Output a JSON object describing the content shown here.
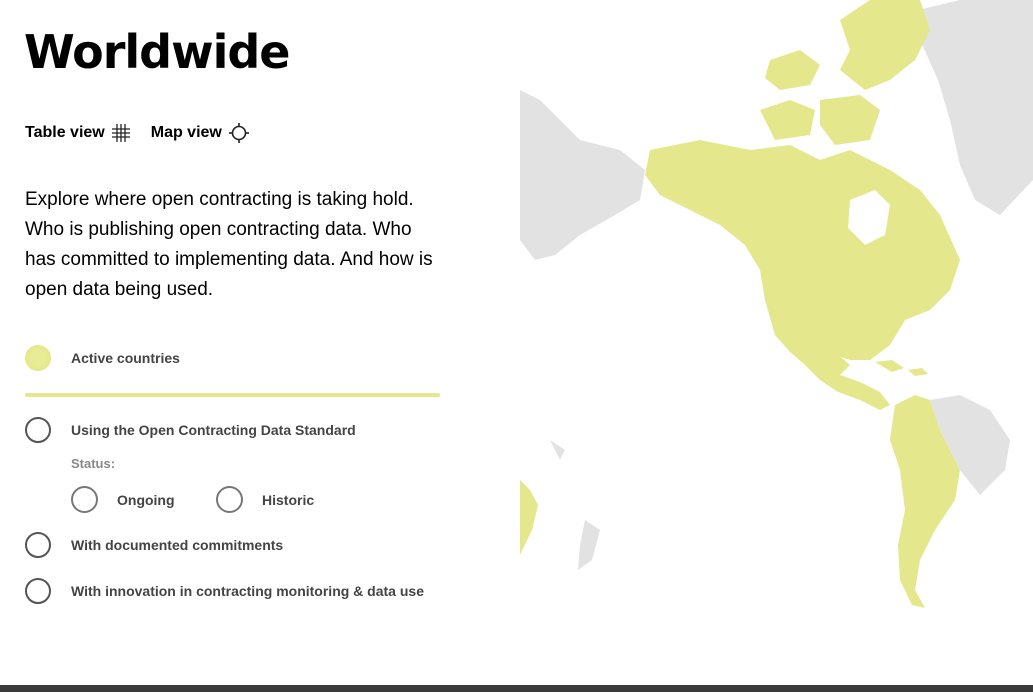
{
  "page": {
    "title": "Worldwide"
  },
  "views": {
    "table_label": "Table view",
    "table_icon": "grid-icon",
    "map_label": "Map view",
    "map_icon": "crosshair-icon"
  },
  "intro": "Explore where open contracting is taking hold. Who is publishing open contracting data. Who has committed to implementing data. And how is open data being used.",
  "legend": {
    "active_label": "Active countries",
    "active_color": "#e4e78c"
  },
  "filters": {
    "ocds_label": "Using the Open Contracting Data Standard",
    "status_label": "Status:",
    "status_options": [
      "Ongoing",
      "Historic"
    ],
    "commitments_label": "With documented commitments",
    "innovation_label": "With innovation in contracting monitoring & data use"
  },
  "map": {
    "active_fill": "#e4e78c",
    "inactive_fill": "#e2e2e2"
  }
}
